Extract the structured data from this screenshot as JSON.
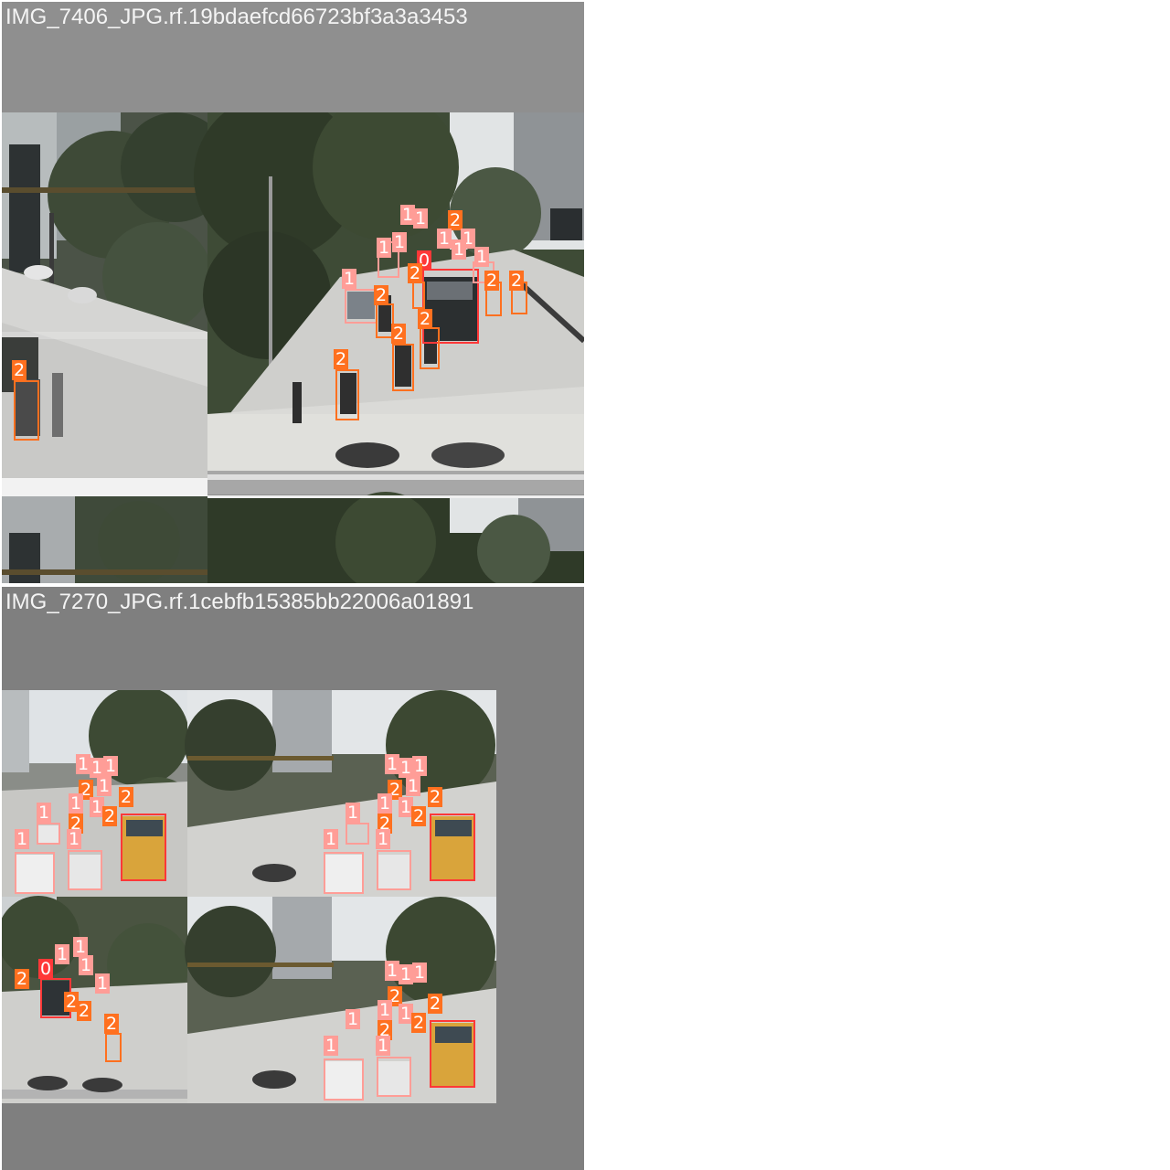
{
  "panels": [
    {
      "title": "IMG_7406_JPG.rf.19bdaefcd66723bf3a3a3453"
    },
    {
      "title": "IMG_7270_JPG.rf.1cebfb15385bb22006a01891"
    }
  ],
  "classes": [
    {
      "id": "0",
      "color": "#ff3838"
    },
    {
      "id": "1",
      "color": "#ff9d97"
    },
    {
      "id": "2",
      "color": "#ff701f"
    }
  ]
}
